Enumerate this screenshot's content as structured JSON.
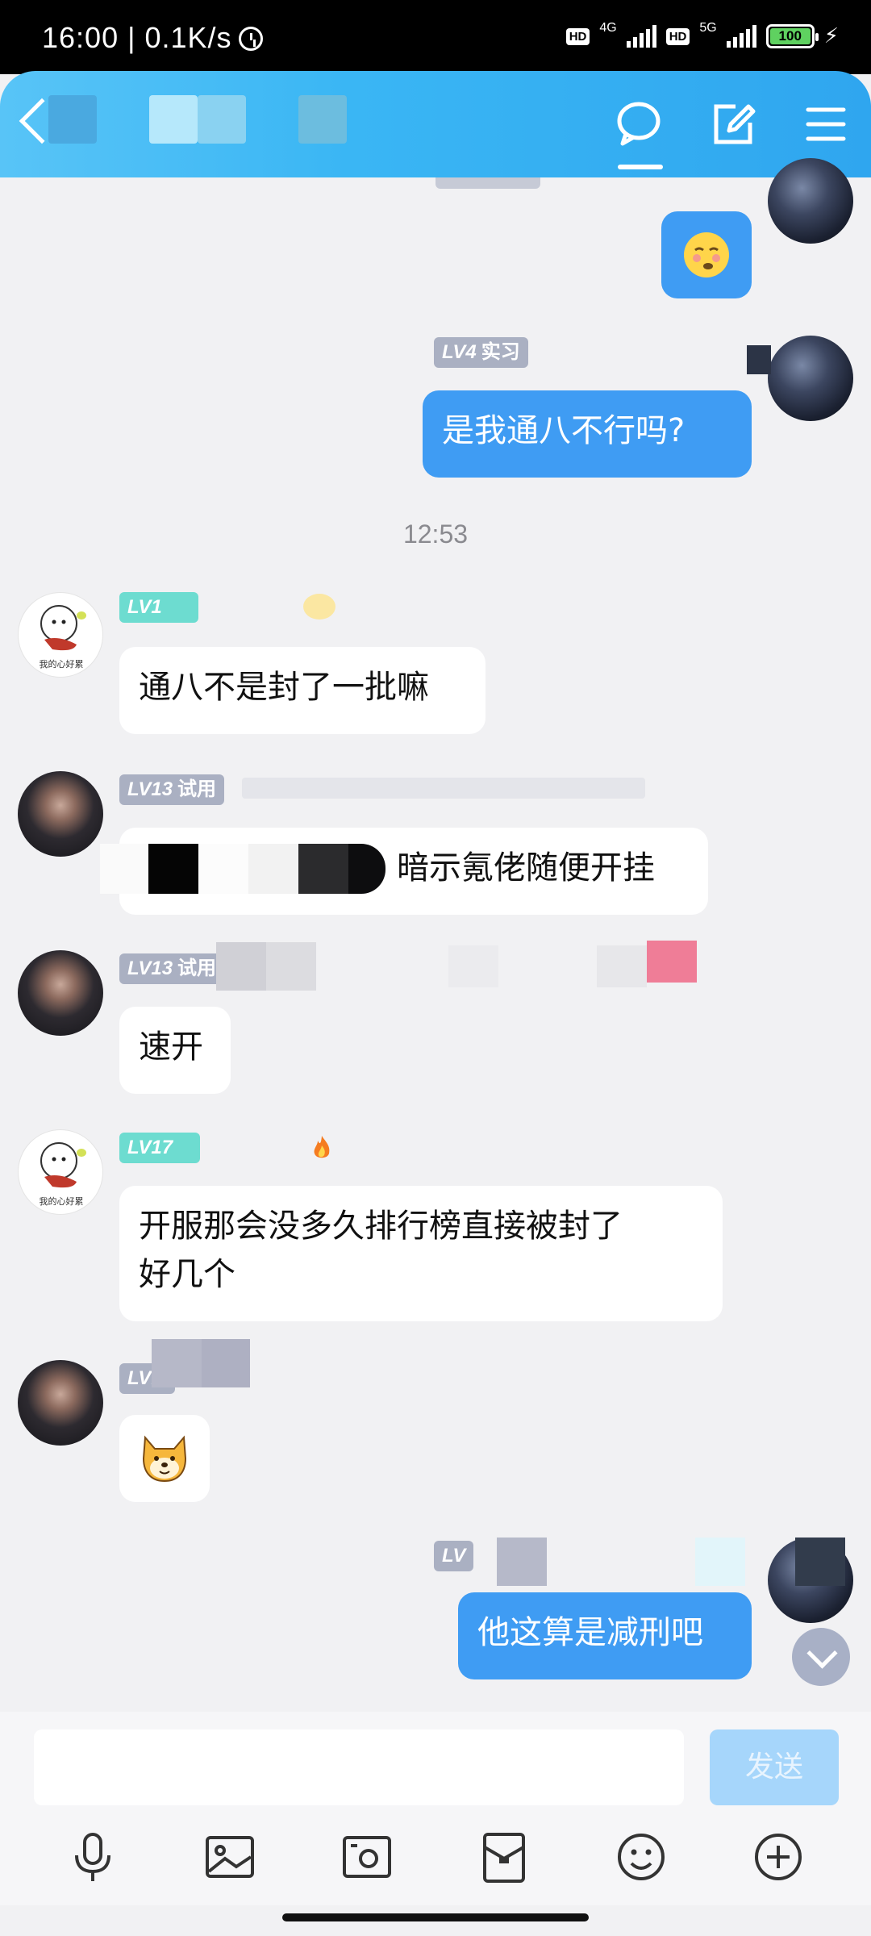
{
  "status_bar": {
    "time": "16:00 | 0.1K/s",
    "hd1": "HD",
    "network1": "4G",
    "hd2": "HD",
    "network2": "5G",
    "battery": "100"
  },
  "header": {
    "back_icon": "chevron-left-icon",
    "icons": [
      "chat-bubble-icon",
      "edit-icon",
      "menu-icon"
    ]
  },
  "messages": [
    {
      "side": "me",
      "level": "",
      "rank": "",
      "emoji": "shy-face-emoji"
    },
    {
      "side": "me",
      "level": "LV4",
      "rank": "实习",
      "text": "是我通八不行吗?"
    },
    {
      "timestamp": "12:53"
    },
    {
      "side": "other",
      "level": "LV1",
      "rank": "",
      "text": "通八不是封了一批嘛"
    },
    {
      "side": "other",
      "level": "LV13",
      "rank": "试用",
      "text": "暗示氪佬随便开挂"
    },
    {
      "side": "other",
      "level": "LV13",
      "rank": "试用",
      "text": "速开"
    },
    {
      "side": "other",
      "level": "LV17",
      "rank": "",
      "text_line1": "开服那会没多久排行榜直接被封了",
      "text_line2": "好几个"
    },
    {
      "side": "other",
      "level": "LV1",
      "rank": "",
      "emoji": "shiba-emoji"
    },
    {
      "side": "me",
      "level": "LV",
      "rank": "",
      "text": "他这算是减刑吧"
    }
  ],
  "input": {
    "placeholder": "",
    "send_label": "发送"
  },
  "toolbar": {
    "icons": [
      "microphone-icon",
      "image-icon",
      "camera-icon",
      "red-packet-icon",
      "emoji-icon",
      "plus-icon"
    ]
  }
}
